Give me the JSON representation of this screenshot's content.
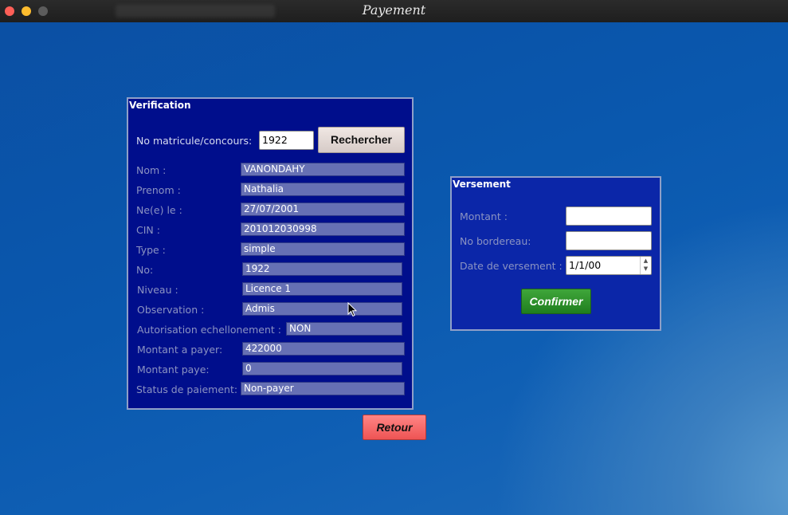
{
  "window": {
    "title": "Payement"
  },
  "verification": {
    "legend": "Verification",
    "search_label": "No matricule/concours:",
    "search_value": "1922",
    "search_button": "Rechercher",
    "fields": {
      "nom": {
        "label": "Nom :",
        "value": "VANONDAHY"
      },
      "prenom": {
        "label": "Prenom :",
        "value": "Nathalia"
      },
      "ne_le": {
        "label": "Ne(e) le :",
        "value": "27/07/2001"
      },
      "cin": {
        "label": "CIN :",
        "value": "201012030998"
      },
      "type": {
        "label": "Type :",
        "value": "simple"
      },
      "no": {
        "label": "No:",
        "value": "1922"
      },
      "niveau": {
        "label": "Niveau :",
        "value": "Licence 1"
      },
      "observation": {
        "label": "Observation :",
        "value": "Admis"
      },
      "autorisation": {
        "label": "Autorisation echellonement :",
        "value": "NON"
      },
      "montant_a_payer": {
        "label": "Montant a payer:",
        "value": "422000"
      },
      "montant_paye": {
        "label": "Montant paye:",
        "value": "0"
      },
      "status": {
        "label": "Status de paiement:",
        "value": "Non-payer"
      }
    }
  },
  "versement": {
    "legend": "Versement",
    "montant_label": "Montant :",
    "montant_value": "",
    "bordereau_label": "No bordereau:",
    "bordereau_value": "",
    "date_label": "Date de versement :",
    "date_value": "1/1/00",
    "confirm_button": "Confirmer"
  },
  "back_button": "Retour"
}
